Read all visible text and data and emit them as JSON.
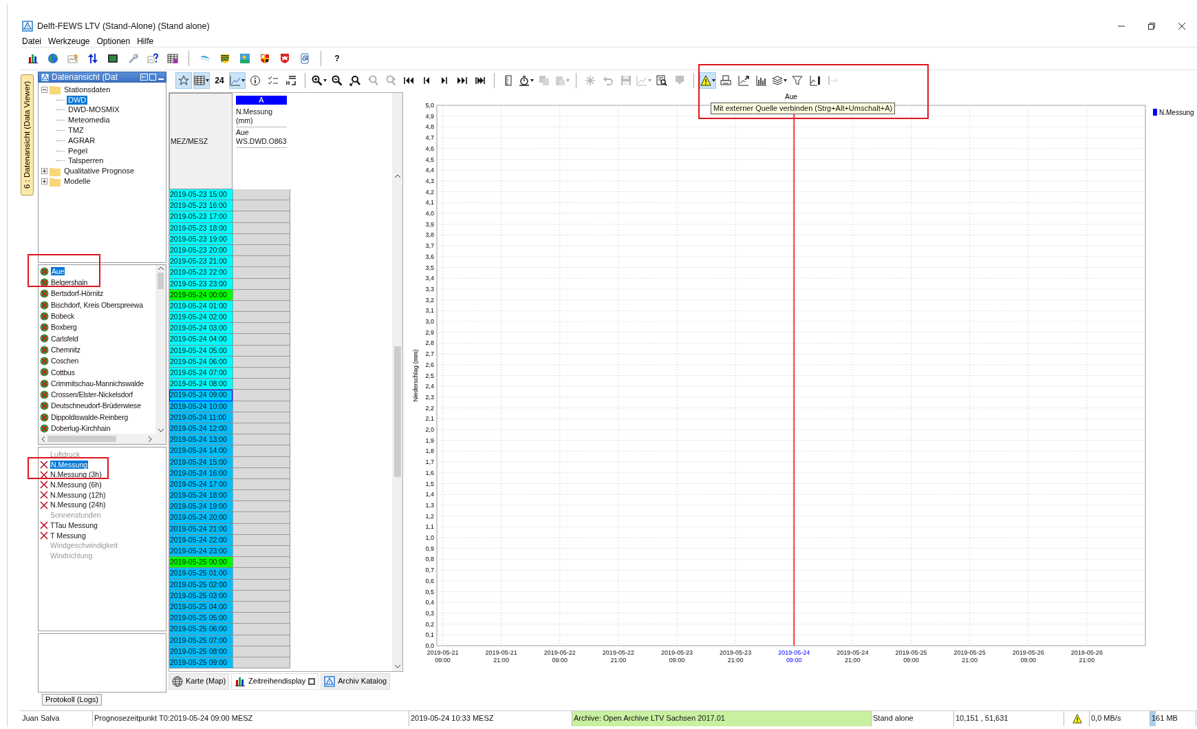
{
  "window": {
    "title": "Delft-FEWS LTV (Stand-Alone)  (Stand alone)"
  },
  "menu": [
    "Datei",
    "Werkzeuge",
    "Optionen",
    "Hilfe"
  ],
  "main_toolbar": [
    {
      "kind": "bars"
    },
    {
      "kind": "globe"
    },
    {
      "kind": "chartup"
    },
    {
      "kind": "updown"
    },
    {
      "kind": "monitor"
    },
    {
      "kind": "wrench"
    },
    {
      "kind": "charthelp"
    },
    {
      "kind": "tablegrid"
    },
    {
      "kind": "separator"
    },
    {
      "kind": "swoosh"
    },
    {
      "kind": "crestgreen"
    },
    {
      "kind": "landscape"
    },
    {
      "kind": "crestred"
    },
    {
      "kind": "eagle"
    },
    {
      "kind": "spiral"
    },
    {
      "kind": "separator"
    },
    {
      "kind": "text",
      "label": "?"
    }
  ],
  "side_tab": {
    "label": "6 : Datenansicht (Data Viewer)"
  },
  "panel": {
    "title": "Datenansicht (Dat"
  },
  "tree": [
    {
      "label": "Stationsdaten",
      "expanded": true,
      "selected": false,
      "children": [
        {
          "label": "DWD",
          "selected": true
        },
        {
          "label": "DWD-MOSMIX",
          "selected": false
        },
        {
          "label": "Meteomedia",
          "selected": false
        },
        {
          "label": "TMZ",
          "selected": false
        },
        {
          "label": "AGRAR",
          "selected": false
        },
        {
          "label": "Pegel",
          "selected": false
        },
        {
          "label": "Talsperren",
          "selected": false
        }
      ]
    },
    {
      "label": "Qualitative Prognose",
      "expanded": false,
      "selected": false
    },
    {
      "label": "Modelle",
      "expanded": false,
      "selected": false
    }
  ],
  "stations": [
    {
      "label": "Aue",
      "selected": true
    },
    {
      "label": "Belgershain",
      "selected": false
    },
    {
      "label": "Bertsdorf-Hörnitz",
      "selected": false
    },
    {
      "label": "Bischdorf, Kreis Oberspreewa",
      "selected": false
    },
    {
      "label": "Bobeck",
      "selected": false
    },
    {
      "label": "Boxberg",
      "selected": false
    },
    {
      "label": "Carlsfeld",
      "selected": false
    },
    {
      "label": "Chemnitz",
      "selected": false
    },
    {
      "label": "Coschen",
      "selected": false
    },
    {
      "label": "Cottbus",
      "selected": false
    },
    {
      "label": "Crimmitschau-Mannichswalde",
      "selected": false
    },
    {
      "label": "Crossen/Elster-Nickelsdorf",
      "selected": false
    },
    {
      "label": "Deutschneudorf-Brüderwiese",
      "selected": false
    },
    {
      "label": "Dippoldiswalde-Reinberg",
      "selected": false
    },
    {
      "label": "Doberlug-Kirchhain",
      "selected": false
    }
  ],
  "parameters": [
    {
      "label": "Luftdruck",
      "available": false,
      "selected": false
    },
    {
      "label": "N.Messung",
      "available": true,
      "selected": true
    },
    {
      "label": "N.Messung (3h)",
      "available": true,
      "selected": false
    },
    {
      "label": "N.Messung (6h)",
      "available": true,
      "selected": false
    },
    {
      "label": "N.Messung (12h)",
      "available": true,
      "selected": false
    },
    {
      "label": "N.Messung (24h)",
      "available": true,
      "selected": false
    },
    {
      "label": "Sonnenstunden",
      "available": false,
      "selected": false
    },
    {
      "label": "TTau Messung",
      "available": true,
      "selected": false
    },
    {
      "label": "T Messung",
      "available": true,
      "selected": false
    },
    {
      "label": "Windgeschwindigkeit",
      "available": false,
      "selected": false
    },
    {
      "label": "Windrichtung",
      "available": false,
      "selected": false
    }
  ],
  "log_tab": {
    "label": "Protokoll (Logs)"
  },
  "viewer_toolbar": [
    {
      "kind": "star",
      "pressed": true,
      "disabled": false,
      "dropdown": false
    },
    {
      "kind": "table",
      "pressed": true,
      "disabled": false,
      "dropdown": true
    },
    {
      "kind": "text",
      "label": "24",
      "pressed": false,
      "disabled": false,
      "dropdown": false
    },
    {
      "kind": "linechart",
      "pressed": true,
      "disabled": false,
      "dropdown": true
    },
    {
      "kind": "info",
      "pressed": false,
      "disabled": false,
      "dropdown": false
    },
    {
      "kind": "checklist",
      "pressed": false,
      "disabled": false,
      "dropdown": false
    },
    {
      "kind": "sort",
      "pressed": false,
      "disabled": false,
      "dropdown": false
    },
    {
      "kind": "separator"
    },
    {
      "kind": "zoomin",
      "pressed": false,
      "disabled": false,
      "dropdown": true
    },
    {
      "kind": "zoomout",
      "pressed": false,
      "disabled": false,
      "dropdown": false
    },
    {
      "kind": "zoomfit",
      "pressed": false,
      "disabled": false,
      "dropdown": false
    },
    {
      "kind": "zoomback",
      "pressed": false,
      "disabled": true,
      "dropdown": false
    },
    {
      "kind": "zoomfwd",
      "pressed": false,
      "disabled": true,
      "dropdown": false
    },
    {
      "kind": "first",
      "pressed": false,
      "disabled": false,
      "dropdown": false
    },
    {
      "kind": "prev",
      "pressed": false,
      "disabled": false,
      "dropdown": false
    },
    {
      "kind": "next",
      "pressed": false,
      "disabled": false,
      "dropdown": false
    },
    {
      "kind": "last",
      "pressed": false,
      "disabled": false,
      "dropdown": false
    },
    {
      "kind": "end",
      "pressed": false,
      "disabled": false,
      "dropdown": false
    },
    {
      "kind": "separator"
    },
    {
      "kind": "ruler",
      "pressed": false,
      "disabled": false,
      "dropdown": false
    },
    {
      "kind": "timer",
      "pressed": false,
      "disabled": false,
      "dropdown": true
    },
    {
      "kind": "copy",
      "pressed": false,
      "disabled": true,
      "dropdown": false
    },
    {
      "kind": "paste",
      "pressed": false,
      "disabled": true,
      "dropdown": true
    },
    {
      "kind": "separator"
    },
    {
      "kind": "sparkle",
      "pressed": false,
      "disabled": true,
      "dropdown": false
    },
    {
      "kind": "undo",
      "pressed": false,
      "disabled": true,
      "dropdown": false
    },
    {
      "kind": "save",
      "pressed": false,
      "disabled": true,
      "dropdown": false
    },
    {
      "kind": "chartedit",
      "pressed": false,
      "disabled": true,
      "dropdown": true
    },
    {
      "kind": "finddoc",
      "pressed": false,
      "disabled": false,
      "dropdown": false
    },
    {
      "kind": "download",
      "pressed": false,
      "disabled": true,
      "dropdown": false
    },
    {
      "kind": "separator"
    },
    {
      "kind": "warning",
      "pressed": true,
      "disabled": false,
      "dropdown": true
    },
    {
      "kind": "printer",
      "pressed": false,
      "disabled": false,
      "dropdown": false
    },
    {
      "kind": "chartexport",
      "pressed": false,
      "disabled": false,
      "dropdown": false
    },
    {
      "kind": "gridchart",
      "pressed": false,
      "disabled": false,
      "dropdown": false
    },
    {
      "kind": "layers",
      "pressed": false,
      "disabled": false,
      "dropdown": true
    },
    {
      "kind": "filter",
      "pressed": false,
      "disabled": false,
      "dropdown": false
    },
    {
      "kind": "legendchart",
      "pressed": false,
      "disabled": false,
      "dropdown": false
    },
    {
      "kind": "split",
      "pressed": false,
      "disabled": true,
      "dropdown": false
    }
  ],
  "table": {
    "time_header": "MEZ/MESZ",
    "column": {
      "letter": "A",
      "parameter": "N.Messung (mm)",
      "location": "Aue WS.DWD.O863"
    },
    "rows": [
      {
        "time": "2019-05-23 15:00",
        "color": "#00ffff",
        "selected": false
      },
      {
        "time": "2019-05-23 16:00",
        "color": "#00ffff",
        "selected": false
      },
      {
        "time": "2019-05-23 17:00",
        "color": "#00ffff",
        "selected": false
      },
      {
        "time": "2019-05-23 18:00",
        "color": "#00ffff",
        "selected": false
      },
      {
        "time": "2019-05-23 19:00",
        "color": "#00ffff",
        "selected": false
      },
      {
        "time": "2019-05-23 20:00",
        "color": "#00ffff",
        "selected": false
      },
      {
        "time": "2019-05-23 21:00",
        "color": "#00ffff",
        "selected": false
      },
      {
        "time": "2019-05-23 22:00",
        "color": "#00ffff",
        "selected": false
      },
      {
        "time": "2019-05-23 23:00",
        "color": "#00ffff",
        "selected": false
      },
      {
        "time": "2019-05-24 00:00",
        "color": "#00ff00",
        "selected": false
      },
      {
        "time": "2019-05-24 01:00",
        "color": "#00ffff",
        "selected": false
      },
      {
        "time": "2019-05-24 02:00",
        "color": "#00ffff",
        "selected": false
      },
      {
        "time": "2019-05-24 03:00",
        "color": "#00ffff",
        "selected": false
      },
      {
        "time": "2019-05-24 04:00",
        "color": "#00ffff",
        "selected": false
      },
      {
        "time": "2019-05-24 05:00",
        "color": "#00ffff",
        "selected": false
      },
      {
        "time": "2019-05-24 06:00",
        "color": "#00ffff",
        "selected": false
      },
      {
        "time": "2019-05-24 07:00",
        "color": "#00ffff",
        "selected": false
      },
      {
        "time": "2019-05-24 08:00",
        "color": "#00ffff",
        "selected": false
      },
      {
        "time": "2019-05-24 09:00",
        "color": "#00ccff",
        "selected": true
      },
      {
        "time": "2019-05-24 10:00",
        "color": "#00bfff",
        "selected": false
      },
      {
        "time": "2019-05-24 11:00",
        "color": "#00bfff",
        "selected": false
      },
      {
        "time": "2019-05-24 12:00",
        "color": "#00bfff",
        "selected": false
      },
      {
        "time": "2019-05-24 13:00",
        "color": "#00bfff",
        "selected": false
      },
      {
        "time": "2019-05-24 14:00",
        "color": "#00bfff",
        "selected": false
      },
      {
        "time": "2019-05-24 15:00",
        "color": "#00bfff",
        "selected": false
      },
      {
        "time": "2019-05-24 16:00",
        "color": "#00bfff",
        "selected": false
      },
      {
        "time": "2019-05-24 17:00",
        "color": "#00bfff",
        "selected": false
      },
      {
        "time": "2019-05-24 18:00",
        "color": "#00bfff",
        "selected": false
      },
      {
        "time": "2019-05-24 19:00",
        "color": "#00bfff",
        "selected": false
      },
      {
        "time": "2019-05-24 20:00",
        "color": "#00bfff",
        "selected": false
      },
      {
        "time": "2019-05-24 21:00",
        "color": "#00bfff",
        "selected": false
      },
      {
        "time": "2019-05-24 22:00",
        "color": "#00bfff",
        "selected": false
      },
      {
        "time": "2019-05-24 23:00",
        "color": "#00bfff",
        "selected": false
      },
      {
        "time": "2019-05-25 00:00",
        "color": "#00ff00",
        "selected": false
      },
      {
        "time": "2019-05-25 01:00",
        "color": "#00bfff",
        "selected": false
      },
      {
        "time": "2019-05-25 02:00",
        "color": "#00bfff",
        "selected": false
      },
      {
        "time": "2019-05-25 03:00",
        "color": "#00bfff",
        "selected": false
      },
      {
        "time": "2019-05-25 04:00",
        "color": "#00bfff",
        "selected": false
      },
      {
        "time": "2019-05-25 05:00",
        "color": "#00bfff",
        "selected": false
      },
      {
        "time": "2019-05-25 06:00",
        "color": "#00bfff",
        "selected": false
      },
      {
        "time": "2019-05-25 07:00",
        "color": "#00bfff",
        "selected": false
      },
      {
        "time": "2019-05-25 08:00",
        "color": "#00bfff",
        "selected": false
      },
      {
        "time": "2019-05-25 09:00",
        "color": "#00bfff",
        "selected": false
      }
    ]
  },
  "chart": {
    "tooltip": "Mit externer Quelle verbinden (Strg+Alt+Umschalt+A)",
    "chart_data": {
      "type": "line",
      "title": "Aue",
      "ylabel": "Niederschlag (mm)",
      "categories": [
        "2019-05-21 09:00",
        "2019-05-21 21:00",
        "2019-05-22 09:00",
        "2019-05-22 21:00",
        "2019-05-23 09:00",
        "2019-05-23 21:00",
        "2019-05-24 09:00",
        "2019-05-24 21:00",
        "2019-05-25 09:00",
        "2019-05-25 21:00",
        "2019-05-26 09:00",
        "2019-05-26 21:00",
        null
      ],
      "series": [
        {
          "name": "N.Messung",
          "color": "#0000ff",
          "values": [
            null,
            null,
            null,
            null,
            null,
            null,
            null,
            null,
            null,
            null,
            null,
            null,
            null
          ]
        }
      ],
      "ylim": [
        0,
        5
      ],
      "yticks": [
        {
          "value": 0,
          "label": "0,0"
        },
        {
          "value": 0.1,
          "label": "0,1"
        },
        {
          "value": 0.2,
          "label": "0,2"
        },
        {
          "value": 0.3,
          "label": "0,3"
        },
        {
          "value": 0.4,
          "label": "0,4"
        },
        {
          "value": 0.5,
          "label": "0,5"
        },
        {
          "value": 0.6,
          "label": "0,6"
        },
        {
          "value": 0.7,
          "label": "0,7"
        },
        {
          "value": 0.8,
          "label": "0,8"
        },
        {
          "value": 0.9,
          "label": "0,9"
        },
        {
          "value": 1,
          "label": "1,0"
        },
        {
          "value": 1.1,
          "label": "1,1"
        },
        {
          "value": 1.2,
          "label": "1,2"
        },
        {
          "value": 1.3,
          "label": "1,3"
        },
        {
          "value": 1.4,
          "label": "1,4"
        },
        {
          "value": 1.5,
          "label": "1,5"
        },
        {
          "value": 1.6,
          "label": "1,6"
        },
        {
          "value": 1.7,
          "label": "1,7"
        },
        {
          "value": 1.8,
          "label": "1,8"
        },
        {
          "value": 1.9,
          "label": "1,9"
        },
        {
          "value": 2,
          "label": "2,0"
        },
        {
          "value": 2.1,
          "label": "2,1"
        },
        {
          "value": 2.2,
          "label": "2,2"
        },
        {
          "value": 2.3,
          "label": "2,3"
        },
        {
          "value": 2.4,
          "label": "2,4"
        },
        {
          "value": 2.5,
          "label": "2,5"
        },
        {
          "value": 2.6,
          "label": "2,6"
        },
        {
          "value": 2.7,
          "label": "2,7"
        },
        {
          "value": 2.8,
          "label": "2,8"
        },
        {
          "value": 2.9,
          "label": "2,9"
        },
        {
          "value": 3,
          "label": "3,0"
        },
        {
          "value": 3.1,
          "label": "3,1"
        },
        {
          "value": 3.2,
          "label": "3,2"
        },
        {
          "value": 3.3,
          "label": "3,3"
        },
        {
          "value": 3.4,
          "label": "3,4"
        },
        {
          "value": 3.5,
          "label": "3,5"
        },
        {
          "value": 3.6,
          "label": "3,6"
        },
        {
          "value": 3.7,
          "label": "3,7"
        },
        {
          "value": 3.8,
          "label": "3,8"
        },
        {
          "value": 3.9,
          "label": "3,9"
        },
        {
          "value": 4,
          "label": "4,0"
        },
        {
          "value": 4.1,
          "label": "4,1"
        },
        {
          "value": 4.2,
          "label": "4,2"
        },
        {
          "value": 4.3,
          "label": "4,3"
        },
        {
          "value": 4.4,
          "label": "4,4"
        },
        {
          "value": 4.5,
          "label": "4,5"
        },
        {
          "value": 4.6,
          "label": "4,6"
        },
        {
          "value": 4.7,
          "label": "4,7"
        },
        {
          "value": 4.8,
          "label": "4,8"
        },
        {
          "value": 4.9,
          "label": "4,9"
        },
        {
          "value": 5,
          "label": "5,0"
        }
      ],
      "grid": true,
      "ref_lines": [
        {
          "axis": "x",
          "value": "2019-05-24 09:00",
          "color": "#ff0000"
        }
      ]
    }
  },
  "bottom_tabs": [
    {
      "label": "Karte (Map)",
      "kind": "globe",
      "selected": false
    },
    {
      "label": "Zeitreihendisplay",
      "kind": "bars",
      "selected": true
    },
    {
      "label": "Archiv Katalog",
      "kind": "logo",
      "selected": false
    }
  ],
  "status_bar": [
    {
      "kind": "text",
      "text": "Juan Salva"
    },
    {
      "kind": "text",
      "text": "Prognosezeitpunkt T0:2019-05-24 09:00 MESZ"
    },
    {
      "kind": "text",
      "text": "2019-05-24 10:33 MESZ"
    },
    {
      "kind": "archive",
      "text": "Archive: Open Archive LTV Sachsen 2017.01"
    },
    {
      "kind": "text",
      "text": "Stand alone"
    },
    {
      "kind": "text",
      "text": "10,151 , 51,631"
    },
    {
      "kind": "warning"
    },
    {
      "kind": "text",
      "text": "0,0 MB/s"
    },
    {
      "kind": "memory",
      "text": "161 MB",
      "level": 0.12
    }
  ],
  "highlights": [
    {
      "kind": "stations"
    },
    {
      "kind": "parameters"
    },
    {
      "kind": "toolbar"
    }
  ]
}
